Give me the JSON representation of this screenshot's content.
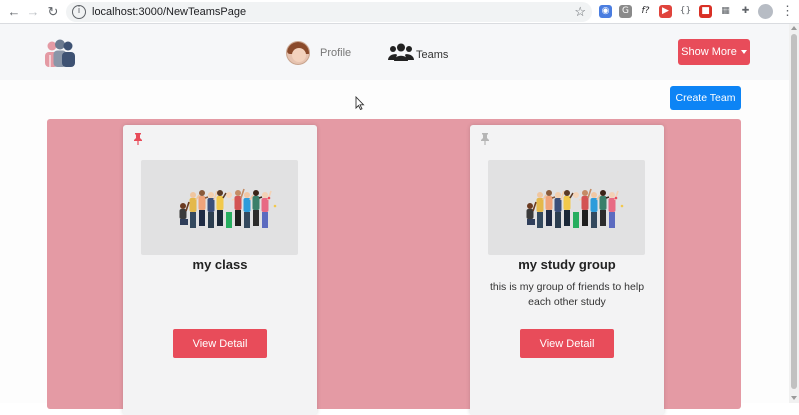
{
  "browser": {
    "url": "localhost:3000/NewTeamsPage",
    "extensions": [
      {
        "name": "camera-extension-icon",
        "color": "#4a7de0",
        "glyph": "◉"
      },
      {
        "name": "translate-extension-icon",
        "color": "#8a8a8a",
        "glyph": "G"
      },
      {
        "name": "formula-extension-icon",
        "color": "#ffffff",
        "glyph": "f?"
      },
      {
        "name": "video-extension-icon",
        "color": "#e0443c",
        "glyph": "▶"
      },
      {
        "name": "code-extension-icon",
        "color": "#5f6368",
        "glyph": "{}"
      },
      {
        "name": "red-extension-icon",
        "color": "#d93025",
        "glyph": "■"
      },
      {
        "name": "grid-extension-icon",
        "color": "#5f6368",
        "glyph": "▦"
      },
      {
        "name": "puzzle-extension-icon",
        "color": "#5f6368",
        "glyph": "✚"
      },
      {
        "name": "playlist-extension-icon",
        "color": "#5f6368",
        "glyph": "≡"
      }
    ]
  },
  "navbar": {
    "profile_label": "Profile",
    "teams_label": "Teams",
    "show_more_label": "Show More"
  },
  "page": {
    "create_team_label": "Create Team",
    "teams": [
      {
        "title": "my class",
        "description": "",
        "pinned": true,
        "pin_color": "#e84c5a",
        "button_label": "View Detail"
      },
      {
        "title": "my study group",
        "description": "this is my group of friends to help each other study",
        "pinned": false,
        "pin_color": "#b5b5b5",
        "button_label": "View Detail"
      }
    ]
  },
  "colors": {
    "accent_red": "#e84c5a",
    "primary_blue": "#0d84f5",
    "panel_pink": "#e49aa4",
    "card_bg": "#f3f3f4"
  }
}
